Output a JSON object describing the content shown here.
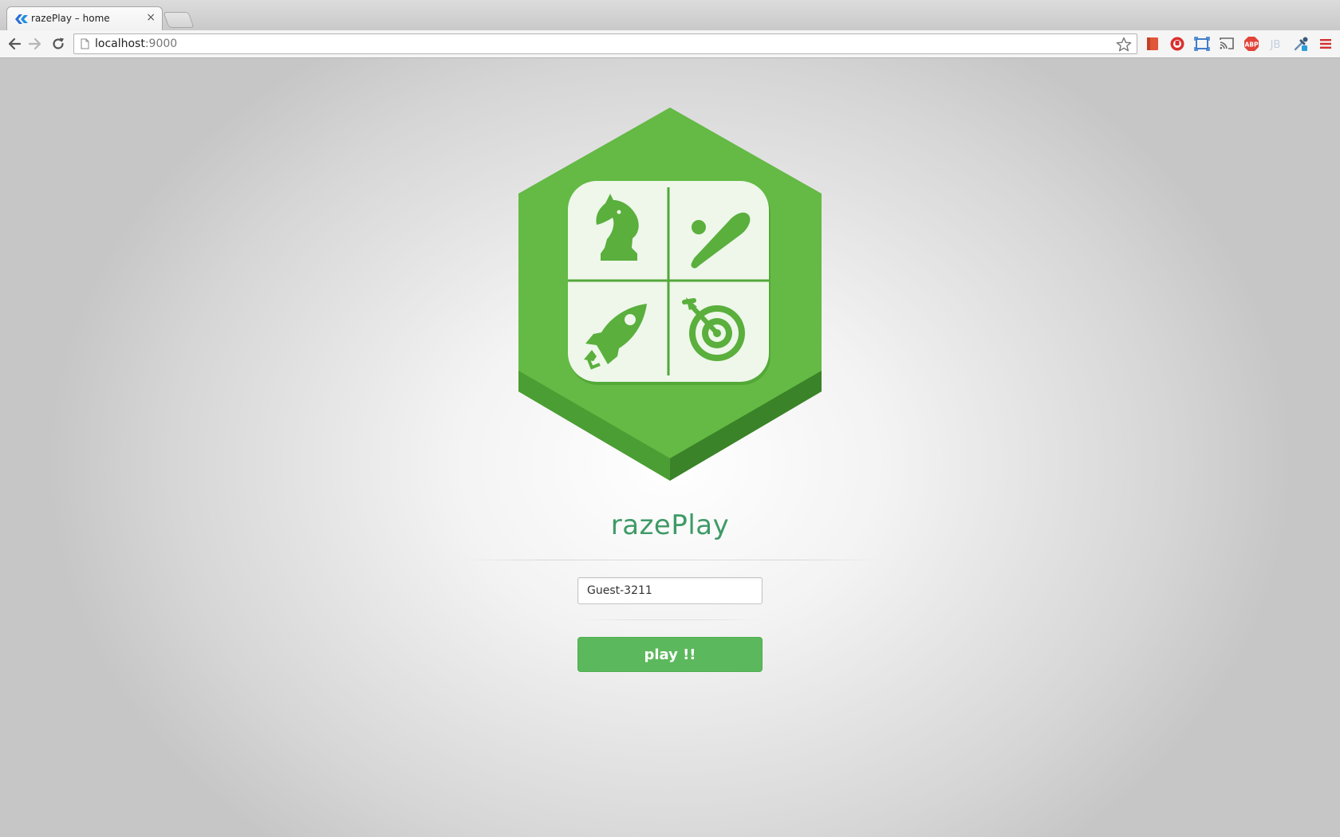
{
  "browser": {
    "tab": {
      "title": "razePlay – home",
      "close_glyph": "×"
    },
    "address_bar": {
      "host": "localhost",
      "port": ":9000"
    },
    "icons": {
      "back": "back-arrow-icon",
      "forward": "forward-arrow-icon",
      "reload": "reload-icon",
      "page": "page-icon",
      "bookmark": "star-icon",
      "extensions": [
        "bookmark-extension-icon",
        "stop-extension-icon",
        "screen-capture-icon",
        "cast-icon",
        "adblock-icon",
        "jetbrains-icon",
        "eyedropper-icon",
        "menu-icon"
      ],
      "adblock_label": "ABP",
      "jetbrains_label": "JB"
    }
  },
  "page": {
    "logo": {
      "quadrants": [
        "chess-knight-icon",
        "baseball-bat-icon",
        "rocket-icon",
        "target-dart-icon"
      ]
    },
    "title": "razePlay",
    "name_input": {
      "value": "Guest-3211"
    },
    "play_button": {
      "label": "play !!"
    }
  },
  "colors": {
    "brand_green": "#63b944",
    "brand_green_dark": "#3e8c2b",
    "title_green": "#3f9a67",
    "button_green": "#5cb85c",
    "tile_background": "#eef7ea"
  }
}
